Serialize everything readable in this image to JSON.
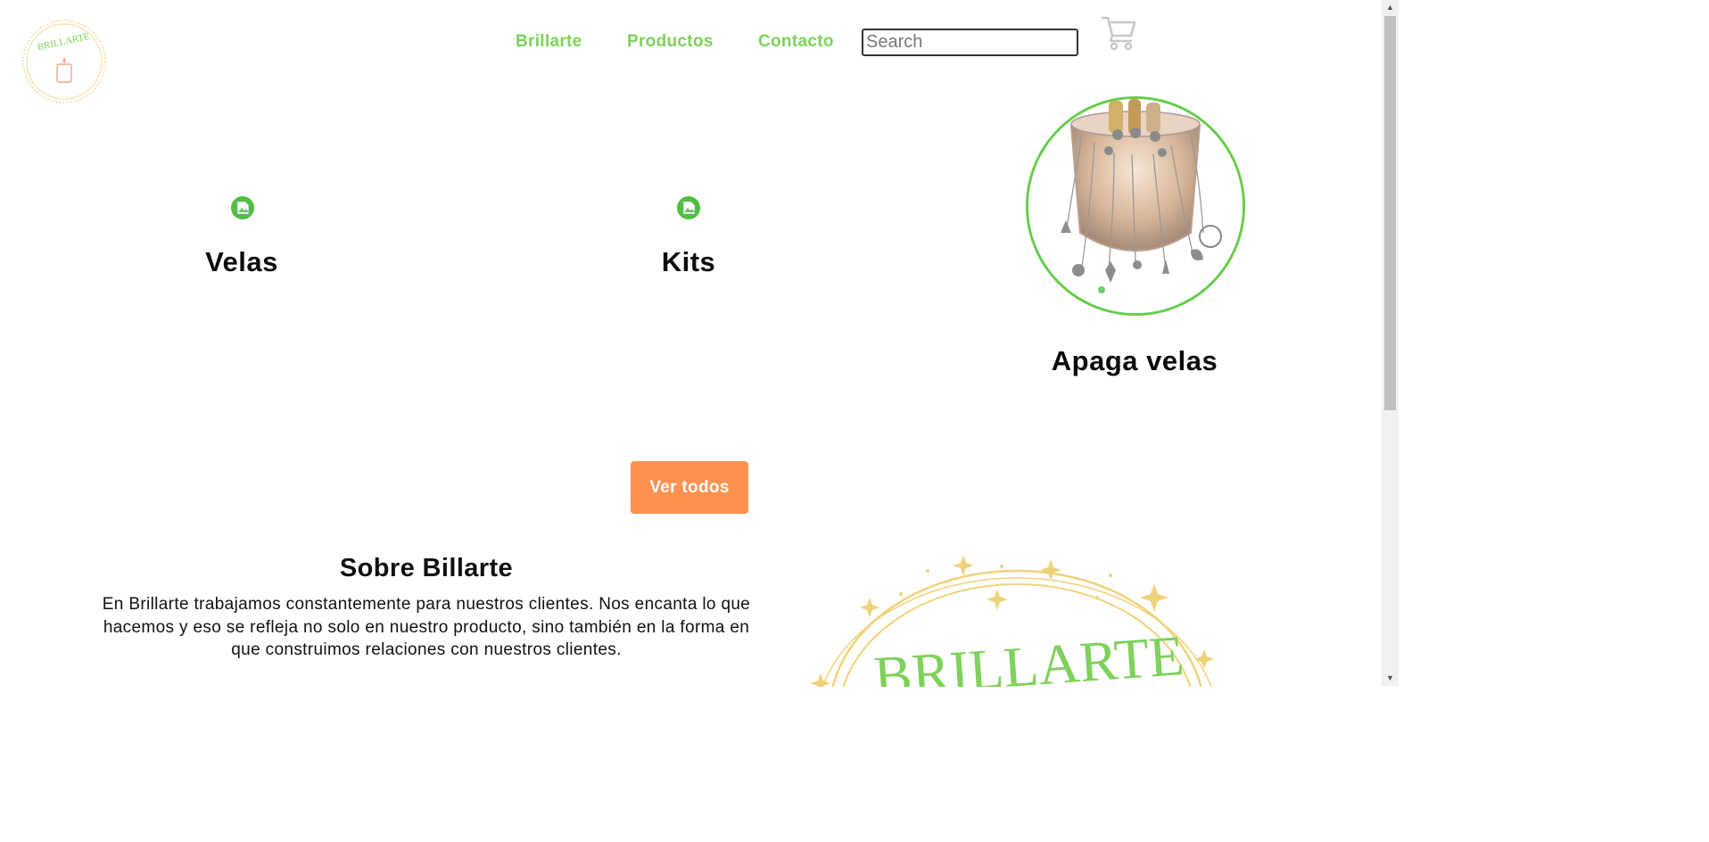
{
  "nav": {
    "links": [
      "Brillarte",
      "Productos",
      "Contacto"
    ],
    "search_placeholder": "Search"
  },
  "logo": {
    "text": "BRILLARTE"
  },
  "categories": [
    {
      "title": "Velas"
    },
    {
      "title": "Kits"
    },
    {
      "title": "Apaga velas"
    }
  ],
  "cta": {
    "label": "Ver todos"
  },
  "about": {
    "title": "Sobre Billarte",
    "text": "En Brillarte trabajamos constantemente para nuestros clientes. Nos encanta lo que hacemos y eso se refleja no solo en nuestro producto, sino también en la forma en que construimos relaciones con nuestros clientes."
  },
  "big_logo": {
    "text": "BRILLARTE"
  },
  "colors": {
    "nav_link": "#7ed15a",
    "button": "#ff9150",
    "circle_border": "#66cc4b",
    "logo_gold": "#f0d27a"
  },
  "icons": [
    "broken-image-icon",
    "cart-icon",
    "scroll-up-icon",
    "scroll-down-icon"
  ]
}
